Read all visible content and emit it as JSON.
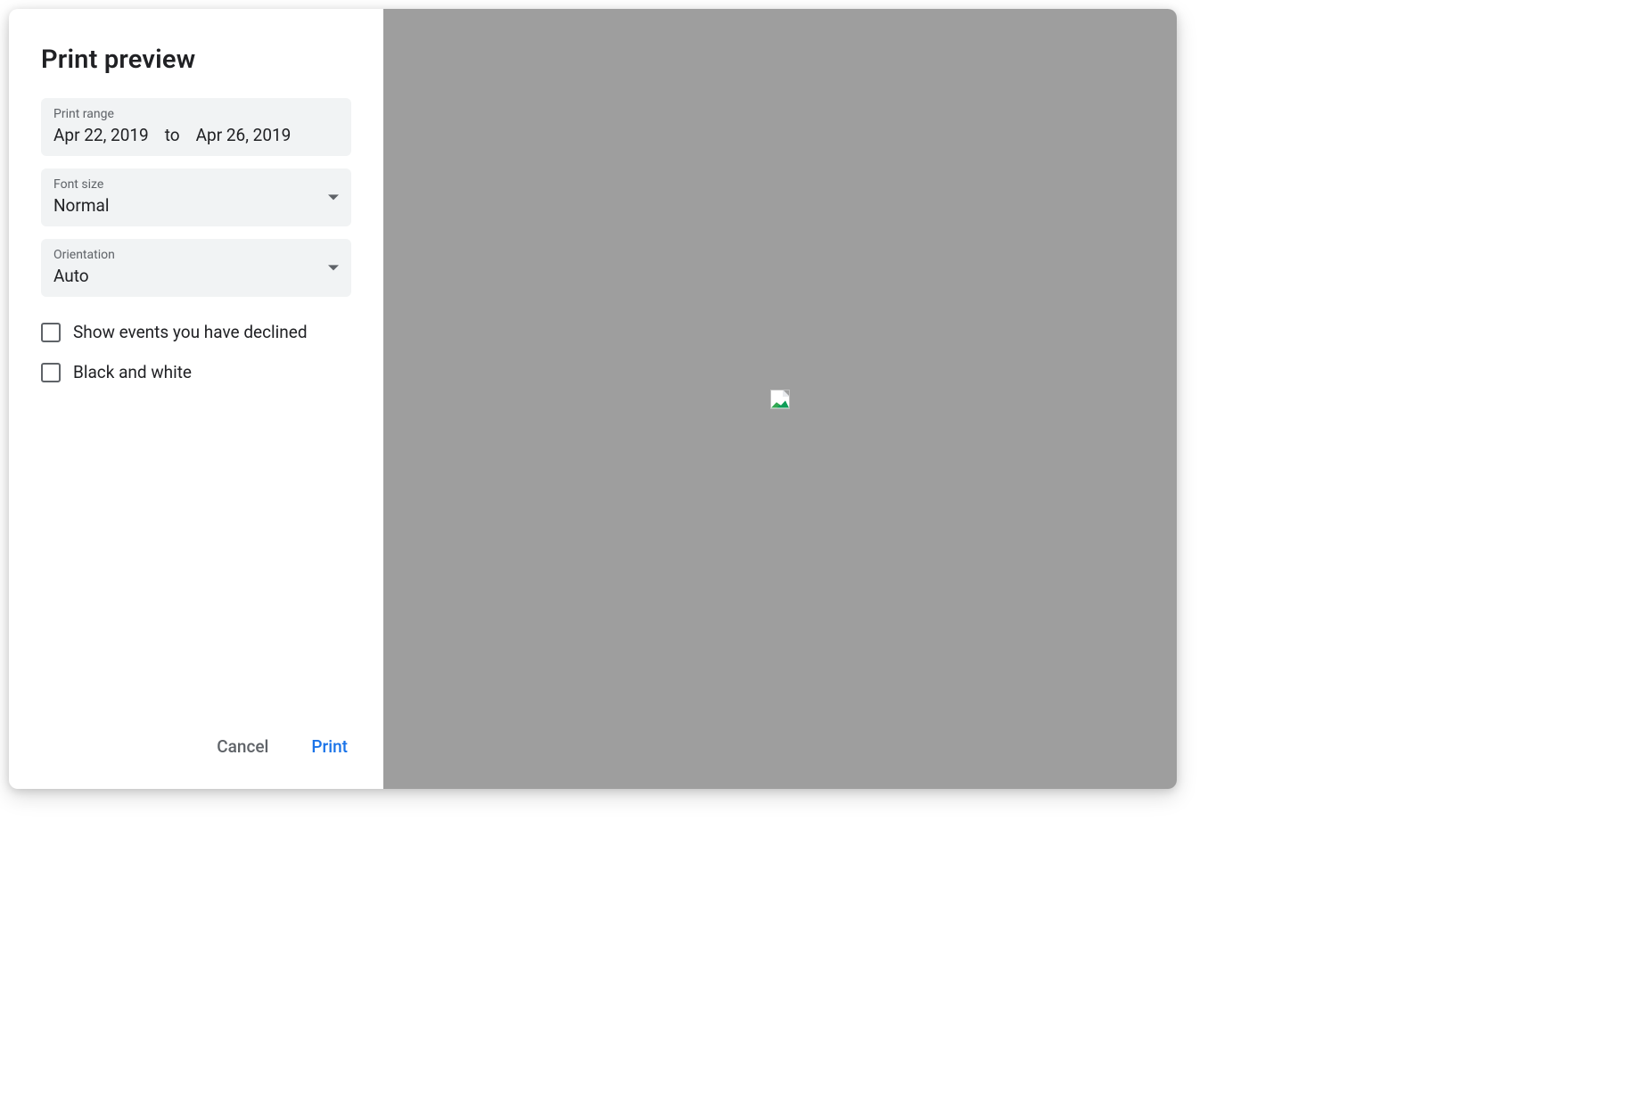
{
  "dialog": {
    "title": "Print preview",
    "print_range": {
      "label": "Print range",
      "start": "Apr 22, 2019",
      "separator": "to",
      "end": "Apr 26, 2019"
    },
    "font_size": {
      "label": "Font size",
      "value": "Normal"
    },
    "orientation": {
      "label": "Orientation",
      "value": "Auto"
    },
    "checkboxes": {
      "declined": {
        "label": "Show events you have declined",
        "checked": false
      },
      "bw": {
        "label": "Black and white",
        "checked": false
      }
    },
    "buttons": {
      "cancel": "Cancel",
      "print": "Print"
    }
  }
}
